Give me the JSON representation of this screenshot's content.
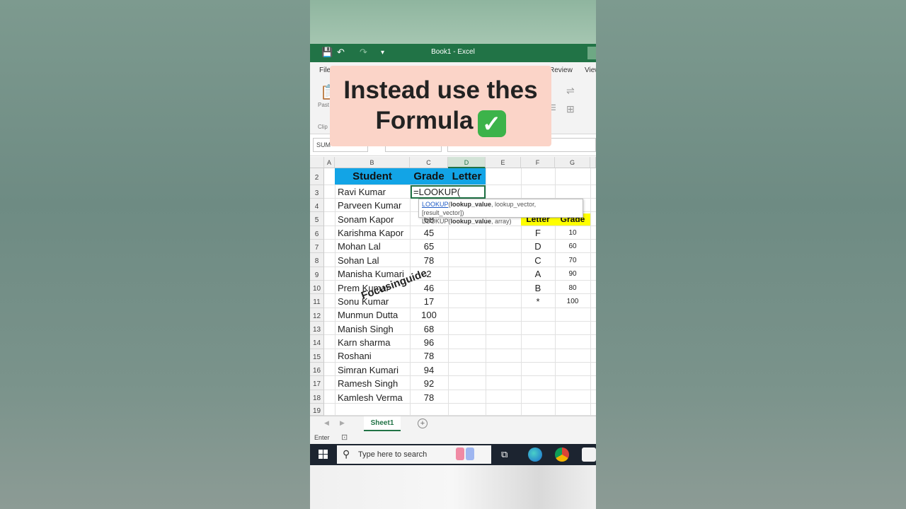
{
  "window": {
    "title": "Book1  -  Excel"
  },
  "ribbon": {
    "tabs": [
      "File",
      "Review",
      "View"
    ],
    "paste_label": "Past",
    "clipboard_label": "Clip"
  },
  "namebox": {
    "value": "SUM"
  },
  "overlay": {
    "line1": "Instead use thes",
    "line2": "Formula",
    "check": "✓"
  },
  "columns": [
    "A",
    "B",
    "C",
    "D",
    "E",
    "F",
    "G"
  ],
  "rows": [
    "2",
    "3",
    "4",
    "5",
    "6",
    "7",
    "8",
    "9",
    "10",
    "11",
    "12",
    "13",
    "14",
    "15",
    "16",
    "17",
    "18",
    "19"
  ],
  "table": {
    "headers": {
      "student": "Student",
      "grade": "Grade",
      "letter": "Letter"
    },
    "students": [
      "Ravi Kumar",
      "Parveen Kumar",
      "Sonam Kapor",
      "Karishma Kapor",
      "Mohan Lal",
      "Sohan Lal",
      "Manisha Kumari",
      "Prem Kumar",
      "Sonu Kumar",
      "Munmun Dutta",
      "Manish Singh",
      "Karn sharma",
      "Roshani",
      "Simran Kumari",
      "Ramesh Singh",
      "Kamlesh Verma"
    ],
    "grades": [
      "",
      "",
      "68",
      "45",
      "65",
      "78",
      "2",
      "46",
      "17",
      "100",
      "68",
      "96",
      "78",
      "94",
      "92",
      "78"
    ]
  },
  "active_cell": {
    "formula": "=LOOKUP("
  },
  "tooltip": {
    "fn1": "LOOKUP",
    "args1_bold": "lookup_value",
    "args1_rest": ", lookup_vector, [result_vector])",
    "fn2": "LOOKUP",
    "args2_bold": "lookup_value",
    "args2_rest": ", array)"
  },
  "lookup_table": {
    "headers": {
      "letter": "Letter",
      "grade": "Grade"
    },
    "letters": [
      "F",
      "D",
      "C",
      "A",
      "B",
      "*"
    ],
    "grades": [
      "10",
      "60",
      "70",
      "90",
      "80",
      "100"
    ]
  },
  "watermark": "Focusinguide",
  "sheet": {
    "tab": "Sheet1",
    "add": "+"
  },
  "status": {
    "mode": "Enter"
  },
  "taskbar": {
    "search_placeholder": "Type here to search"
  },
  "colors": {
    "excel_green": "#217346",
    "header_blue": "#12a4e6",
    "yellow": "#ffff00",
    "banner": "#fbd4c8"
  }
}
